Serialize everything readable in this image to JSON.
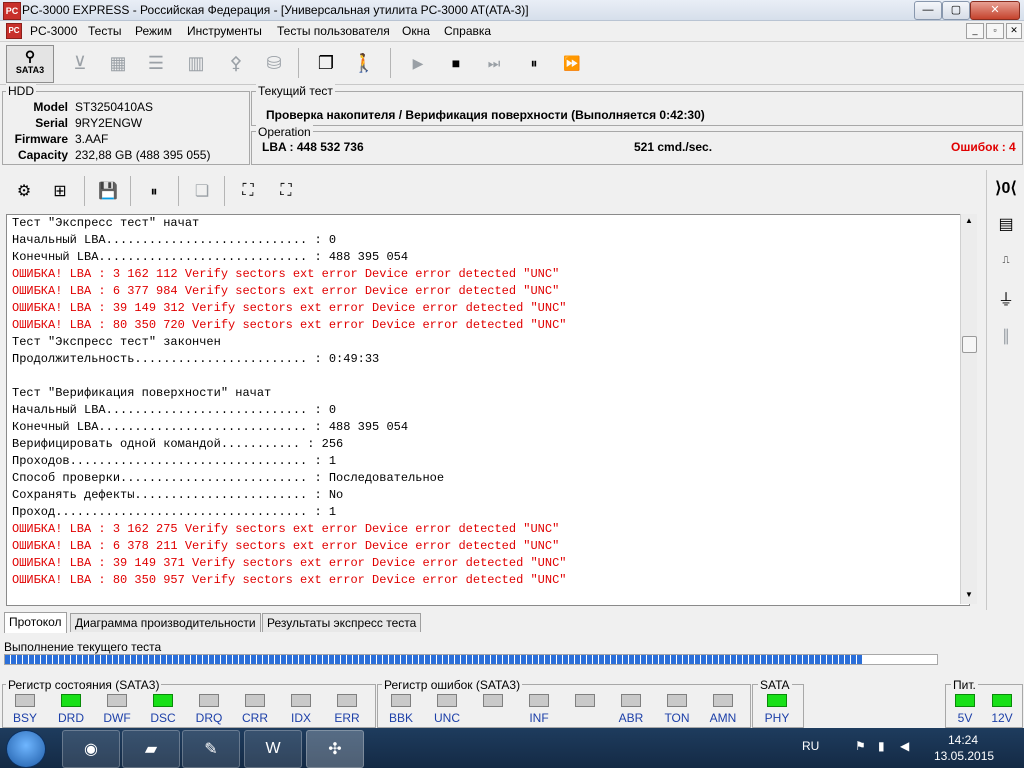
{
  "window": {
    "title": "PC-3000 EXPRESS - Российская Федерация - [Универсальная утилита PC-3000 AT(ATA-3)]",
    "app_icon": "pc3000-icon",
    "min": "—",
    "max": "▢",
    "close": "✕"
  },
  "menubar": {
    "items": [
      "PC-3000",
      "Тесты",
      "Режим",
      "Инструменты",
      "Тесты пользователя",
      "Окна",
      "Справка"
    ],
    "mdi": [
      "_",
      "▫",
      "✕"
    ]
  },
  "toolbar": {
    "sata_label": "SATA3",
    "icons": [
      "drive-icon",
      "chip-icon",
      "list-icon",
      "chart-icon",
      "tool-icon",
      "disk-icon",
      "windows-icon",
      "run-icon"
    ],
    "media": [
      "▶",
      "■",
      "⏭",
      "⏸",
      "⏩"
    ]
  },
  "hdd": {
    "label": "HDD",
    "fields": [
      {
        "key": "Model",
        "value": "ST3250410AS"
      },
      {
        "key": "Serial",
        "value": "9RY2ENGW"
      },
      {
        "key": "Firmware",
        "value": "3.AAF"
      },
      {
        "key": "Capacity",
        "value": "232,88 GB (488 395 055)"
      }
    ]
  },
  "current_test": {
    "label": "Текущий тест",
    "value": "Проверка накопителя / Верификация поверхности (Выполняется 0:42:30)"
  },
  "operation": {
    "label": "Operation",
    "lba": "LBA : 448 532 736",
    "speed": "521 cmd./sec.",
    "errors_label": "Ошибок :",
    "errors_count": "4",
    "error_color": "#e00000"
  },
  "log": {
    "lines": [
      {
        "text": "Тест \"Экспресс тест\" начат",
        "err": false
      },
      {
        "text": "Начальный LBA............................ : 0",
        "err": false
      },
      {
        "text": "Конечный LBA............................. : 488 395 054",
        "err": false
      },
      {
        "text": "ОШИБКА! LBA : 3 162 112 Verify sectors ext error Device error detected \"UNC\"",
        "err": true
      },
      {
        "text": "ОШИБКА! LBA : 6 377 984 Verify sectors ext error Device error detected \"UNC\"",
        "err": true
      },
      {
        "text": "ОШИБКА! LBA : 39 149 312 Verify sectors ext error Device error detected \"UNC\"",
        "err": true
      },
      {
        "text": "ОШИБКА! LBA : 80 350 720 Verify sectors ext error Device error detected \"UNC\"",
        "err": true
      },
      {
        "text": "Тест \"Экспресс тест\" закончен",
        "err": false
      },
      {
        "text": "Продолжительность........................ : 0:49:33",
        "err": false
      },
      {
        "text": "",
        "err": false
      },
      {
        "text": "Тест \"Верификация поверхности\" начат",
        "err": false
      },
      {
        "text": "Начальный LBA............................ : 0",
        "err": false
      },
      {
        "text": "Конечный LBA............................. : 488 395 054",
        "err": false
      },
      {
        "text": "Верифицировать одной командой........... : 256",
        "err": false
      },
      {
        "text": "Проходов................................. : 1",
        "err": false
      },
      {
        "text": "Способ проверки.......................... : Последовательное",
        "err": false
      },
      {
        "text": "Сохранять дефекты........................ : No",
        "err": false
      },
      {
        "text": "Проход................................... : 1",
        "err": false
      },
      {
        "text": "ОШИБКА! LBA : 3 162 275 Verify sectors ext error Device error detected \"UNC\"",
        "err": true
      },
      {
        "text": "ОШИБКА! LBA : 6 378 211 Verify sectors ext error Device error detected \"UNC\"",
        "err": true
      },
      {
        "text": "ОШИБКА! LBA : 39 149 371 Verify sectors ext error Device error detected \"UNC\"",
        "err": true
      },
      {
        "text": "ОШИБКА! LBA : 80 350 957 Verify sectors ext error Device error detected \"UNC\"",
        "err": true
      }
    ]
  },
  "tabs": [
    "Протокол",
    "Диаграмма производительности",
    "Результаты экспресс теста"
  ],
  "progress": {
    "label": "Выполнение текущего теста",
    "fraction": 0.92,
    "color": "#2b6fd9"
  },
  "status_register": {
    "label": "Регистр состояния (SATA3)",
    "leds": [
      {
        "name": "BSY",
        "on": false
      },
      {
        "name": "DRD",
        "on": true
      },
      {
        "name": "DWF",
        "on": false
      },
      {
        "name": "DSC",
        "on": true
      },
      {
        "name": "DRQ",
        "on": false
      },
      {
        "name": "CRR",
        "on": false
      },
      {
        "name": "IDX",
        "on": false
      },
      {
        "name": "ERR",
        "on": false
      }
    ]
  },
  "error_register": {
    "label": "Регистр ошибок (SATA3)",
    "leds": [
      {
        "name": "BBK",
        "on": false
      },
      {
        "name": "UNC",
        "on": false
      },
      {
        "name": "",
        "on": false
      },
      {
        "name": "INF",
        "on": false
      },
      {
        "name": "",
        "on": false
      },
      {
        "name": "ABR",
        "on": false
      },
      {
        "name": "TON",
        "on": false
      },
      {
        "name": "AMN",
        "on": false
      }
    ]
  },
  "sata_panel": {
    "label": "SATA",
    "led": "PHY",
    "on": true
  },
  "power_panel": {
    "label": "Пит.",
    "leds": [
      {
        "name": "5V",
        "on": true
      },
      {
        "name": "12V",
        "on": true
      }
    ]
  },
  "taskbar": {
    "apps": [
      "chrome-icon",
      "folder-icon",
      "pdf-icon",
      "word-icon",
      "pc3000-icon"
    ],
    "lang": "RU",
    "time": "14:24",
    "date": "13.05.2015"
  }
}
